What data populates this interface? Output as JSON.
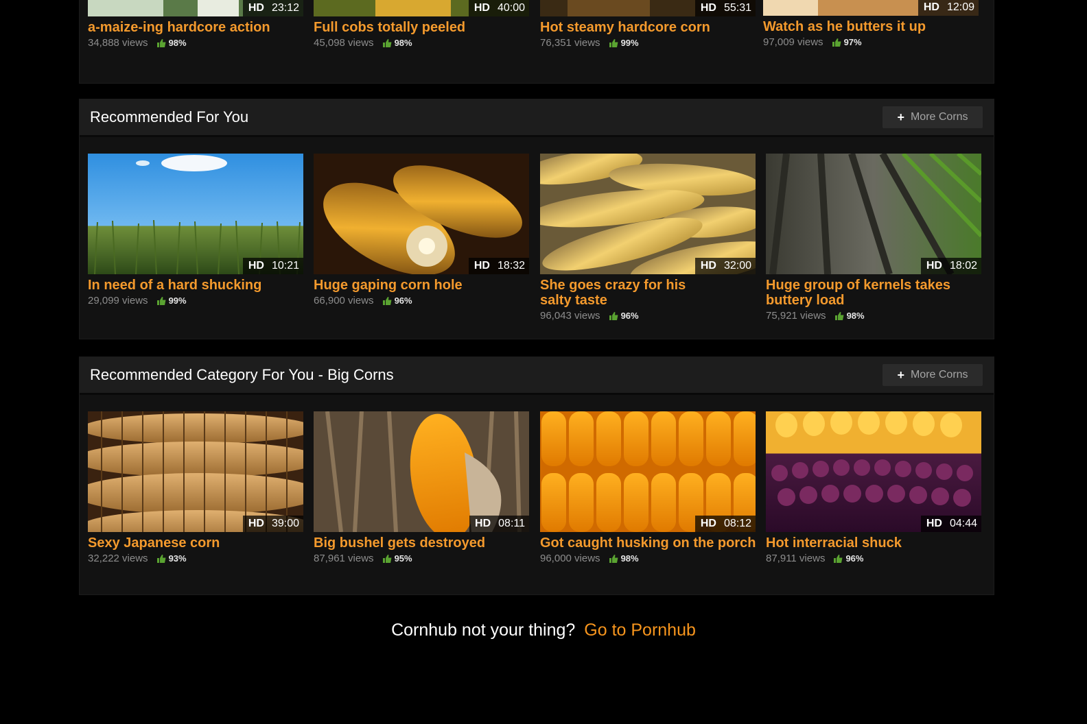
{
  "colors": {
    "accent": "#f49a2d",
    "link": "#f7951d",
    "rating_icon": "#5aa331"
  },
  "top_row": {
    "videos": [
      {
        "title": "a-maize-ing hardcore action",
        "views": "34,888 views",
        "rating": "98%",
        "hd": "HD",
        "duration": "23:12"
      },
      {
        "title": "Full cobs totally peeled",
        "views": "45,098 views",
        "rating": "98%",
        "hd": "HD",
        "duration": "40:00"
      },
      {
        "title": "Hot steamy hardcore corn",
        "views": "76,351 views",
        "rating": "99%",
        "hd": "HD",
        "duration": "55:31"
      },
      {
        "title": "Watch as he butters it up",
        "views": "97,009 views",
        "rating": "97%",
        "hd": "HD",
        "duration": "12:09"
      }
    ]
  },
  "recommended": {
    "title": "Recommended For You",
    "more_label": "More Corns",
    "videos": [
      {
        "title": "In need of a hard shucking",
        "views": "29,099 views",
        "rating": "99%",
        "hd": "HD",
        "duration": "10:21"
      },
      {
        "title": "Huge gaping corn hole",
        "views": "66,900 views",
        "rating": "96%",
        "hd": "HD",
        "duration": "18:32"
      },
      {
        "title": "She goes crazy for his salty taste",
        "views": "96,043 views",
        "rating": "96%",
        "hd": "HD",
        "duration": "32:00"
      },
      {
        "title": "Huge group of kernels takes buttery load",
        "views": "75,921 views",
        "rating": "98%",
        "hd": "HD",
        "duration": "18:02"
      }
    ]
  },
  "category": {
    "title": "Recommended Category For You - Big Corns",
    "more_label": "More Corns",
    "videos": [
      {
        "title": "Sexy Japanese corn",
        "views": "32,222 views",
        "rating": "93%",
        "hd": "HD",
        "duration": "39:00"
      },
      {
        "title": "Big bushel gets destroyed",
        "views": "87,961 views",
        "rating": "95%",
        "hd": "HD",
        "duration": "08:11"
      },
      {
        "title": "Got caught husking on the porch",
        "views": "96,000 views",
        "rating": "98%",
        "hd": "HD",
        "duration": "08:12"
      },
      {
        "title": "Hot interracial shuck",
        "views": "87,911 views",
        "rating": "96%",
        "hd": "HD",
        "duration": "04:44"
      }
    ]
  },
  "footer": {
    "text": "Cornhub not your thing?",
    "link": "Go to Pornhub"
  }
}
